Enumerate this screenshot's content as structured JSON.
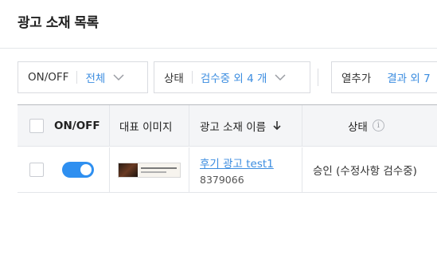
{
  "page": {
    "title": "광고 소재 목록"
  },
  "filters": {
    "onoff": {
      "label": "ON/OFF",
      "value": "전체"
    },
    "status": {
      "label": "상태",
      "value": "검수중 외 4 개"
    },
    "columns": {
      "label": "열추가",
      "value": "결과 외 7"
    }
  },
  "table": {
    "headers": {
      "onoff": "ON/OFF",
      "image": "대표 이미지",
      "name": "광고 소재 이름",
      "status": "상태"
    },
    "rows": [
      {
        "enabled": true,
        "name": "후기 광고 test1",
        "id": "8379066",
        "status": "승인 (수정사항 검수중)"
      }
    ]
  },
  "colors": {
    "accent": "#3c8de0",
    "toggle_on": "#2e8ff0"
  },
  "icons": [
    "chevron-down-icon",
    "sort-arrow-down-icon",
    "info-icon",
    "checkbox",
    "toggle-switch"
  ]
}
